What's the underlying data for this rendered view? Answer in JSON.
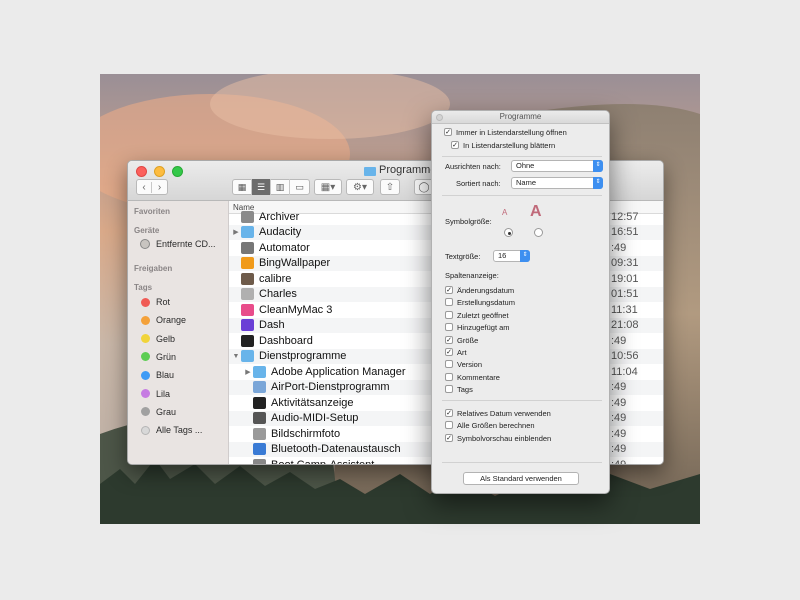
{
  "finder": {
    "title": "Programme",
    "column_name": "Name",
    "sidebar": {
      "favorites_header": "Favoriten",
      "devices_header": "Geräte",
      "devices": [
        "Entfernte CD..."
      ],
      "shared_header": "Freigaben",
      "tags_header": "Tags",
      "tags": [
        {
          "label": "Rot",
          "color": "#f05b55"
        },
        {
          "label": "Orange",
          "color": "#f4a13a"
        },
        {
          "label": "Gelb",
          "color": "#f1d43a"
        },
        {
          "label": "Grün",
          "color": "#5dcd53"
        },
        {
          "label": "Blau",
          "color": "#3e9bf5"
        },
        {
          "label": "Lila",
          "color": "#c67ce2"
        },
        {
          "label": "Grau",
          "color": "#a1a1a1"
        },
        {
          "label": "Alle Tags ...",
          "color": "#d8d8d8"
        }
      ]
    },
    "files": [
      {
        "name": "Archiver",
        "date": "12:57",
        "icon": "archiver-icon",
        "color": "#8a8a8a",
        "disclosure": "",
        "indent": 0
      },
      {
        "name": "Audacity",
        "date": "16:51",
        "icon": "folder-icon",
        "color": "#68b4ea",
        "disclosure": "▶",
        "indent": 0
      },
      {
        "name": "Automator",
        "date": ":49",
        "icon": "automator-icon",
        "color": "#777777",
        "disclosure": "",
        "indent": 0
      },
      {
        "name": "BingWallpaper",
        "date": "09:31",
        "icon": "bing-icon",
        "color": "#f09a1a",
        "disclosure": "",
        "indent": 0
      },
      {
        "name": "calibre",
        "date": "19:01",
        "icon": "calibre-icon",
        "color": "#6e5b4a",
        "disclosure": "",
        "indent": 0
      },
      {
        "name": "Charles",
        "date": "01:51",
        "icon": "charles-icon",
        "color": "#b0b0b0",
        "disclosure": "",
        "indent": 0
      },
      {
        "name": "CleanMyMac 3",
        "date": "11:31",
        "icon": "cleanmymac-icon",
        "color": "#e84c8a",
        "disclosure": "",
        "indent": 0
      },
      {
        "name": "Dash",
        "date": "21:08",
        "icon": "dash-icon",
        "color": "#6a3fd6",
        "disclosure": "",
        "indent": 0
      },
      {
        "name": "Dashboard",
        "date": ":49",
        "icon": "dashboard-icon",
        "color": "#222222",
        "disclosure": "",
        "indent": 0
      },
      {
        "name": "Dienstprogramme",
        "date": "10:56",
        "icon": "folder-icon",
        "color": "#68b4ea",
        "disclosure": "▼",
        "indent": 0
      },
      {
        "name": "Adobe Application Manager",
        "date": "11:04",
        "icon": "folder-icon",
        "color": "#68b4ea",
        "disclosure": "▶",
        "indent": 1
      },
      {
        "name": "AirPort-Dienstprogramm",
        "date": ":49",
        "icon": "airport-icon",
        "color": "#7aa6d8",
        "disclosure": "",
        "indent": 1
      },
      {
        "name": "Aktivitätsanzeige",
        "date": ":49",
        "icon": "activity-monitor-icon",
        "color": "#222222",
        "disclosure": "",
        "indent": 1
      },
      {
        "name": "Audio-MIDI-Setup",
        "date": ":49",
        "icon": "midi-icon",
        "color": "#555555",
        "disclosure": "",
        "indent": 1
      },
      {
        "name": "Bildschirmfoto",
        "date": ":49",
        "icon": "screenshot-icon",
        "color": "#9a9a9a",
        "disclosure": "",
        "indent": 1
      },
      {
        "name": "Bluetooth-Datenaustausch",
        "date": ":49",
        "icon": "bluetooth-icon",
        "color": "#3a7bd5",
        "disclosure": "",
        "indent": 1
      },
      {
        "name": "Boot Camp-Assistent",
        "date": ":49",
        "icon": "bootcamp-icon",
        "color": "#888888",
        "disclosure": "",
        "indent": 1
      }
    ]
  },
  "panel": {
    "title": "Programme",
    "always_list": "Immer in Listendarstellung öffnen",
    "browse_list": "In Listendarstellung blättern",
    "align_label": "Ausrichten nach:",
    "align_value": "Ohne",
    "sort_label": "Sortiert nach:",
    "sort_value": "Name",
    "icon_size_label": "Symbolgröße:",
    "text_size_label": "Textgröße:",
    "text_size_value": "16",
    "columns_label": "Spaltenanzeige:",
    "columns": [
      {
        "label": "Änderungsdatum",
        "checked": true
      },
      {
        "label": "Erstellungsdatum",
        "checked": false
      },
      {
        "label": "Zuletzt geöffnet",
        "checked": false
      },
      {
        "label": "Hinzugefügt am",
        "checked": false
      },
      {
        "label": "Größe",
        "checked": true
      },
      {
        "label": "Art",
        "checked": true
      },
      {
        "label": "Version",
        "checked": false
      },
      {
        "label": "Kommentare",
        "checked": false
      },
      {
        "label": "Tags",
        "checked": false
      }
    ],
    "extras": [
      {
        "label": "Relatives Datum verwenden",
        "checked": true
      },
      {
        "label": "Alle Größen berechnen",
        "checked": false
      },
      {
        "label": "Symbolvorschau einblenden",
        "checked": true
      }
    ],
    "default_button": "Als Standard verwenden"
  }
}
